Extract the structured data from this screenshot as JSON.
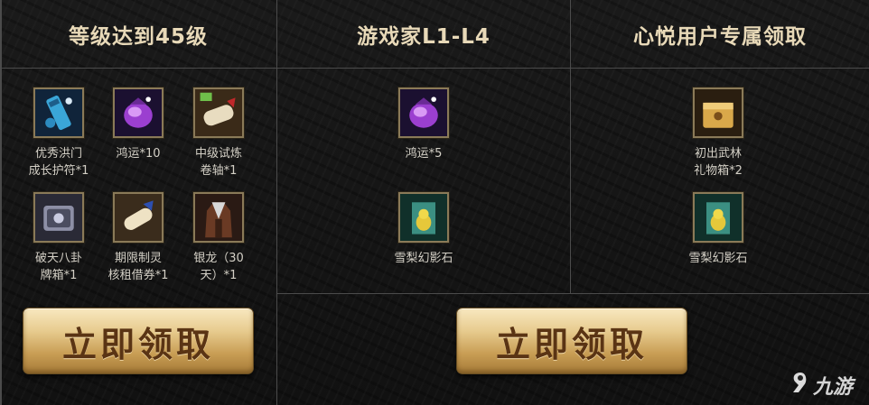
{
  "columns": [
    {
      "title": "等级达到45级"
    },
    {
      "title": "游戏家L1-L4"
    },
    {
      "title": "心悦用户专属领取"
    }
  ],
  "col1_items": [
    {
      "icon": "talisman-icon",
      "label": "优秀洪门\n成长护符*1"
    },
    {
      "icon": "purple-gem-bag-icon",
      "label": "鸿运*10"
    },
    {
      "icon": "trial-scroll-icon",
      "label": "中级试炼\n卷轴*1"
    },
    {
      "icon": "bagua-box-icon",
      "label": "破天八卦\n牌箱*1"
    },
    {
      "icon": "lease-scroll-icon",
      "label": "期限制灵\n核租借券*1"
    },
    {
      "icon": "silver-dragon-outfit-icon",
      "label": "银龙（30\n天）*1"
    }
  ],
  "col2_items": [
    {
      "icon": "purple-gem-bag-icon",
      "label": "鸿运*5"
    },
    {
      "icon": "phantom-stone-icon",
      "label": "雪梨幻影石"
    }
  ],
  "col3_items": [
    {
      "icon": "gift-chest-icon",
      "label": "初出武林\n礼物箱*2"
    },
    {
      "icon": "phantom-stone-icon",
      "label": "雪梨幻影石"
    }
  ],
  "buttons": {
    "claim_left": "立即领取",
    "claim_right": "立即领取"
  },
  "watermark": {
    "text": "九游"
  }
}
